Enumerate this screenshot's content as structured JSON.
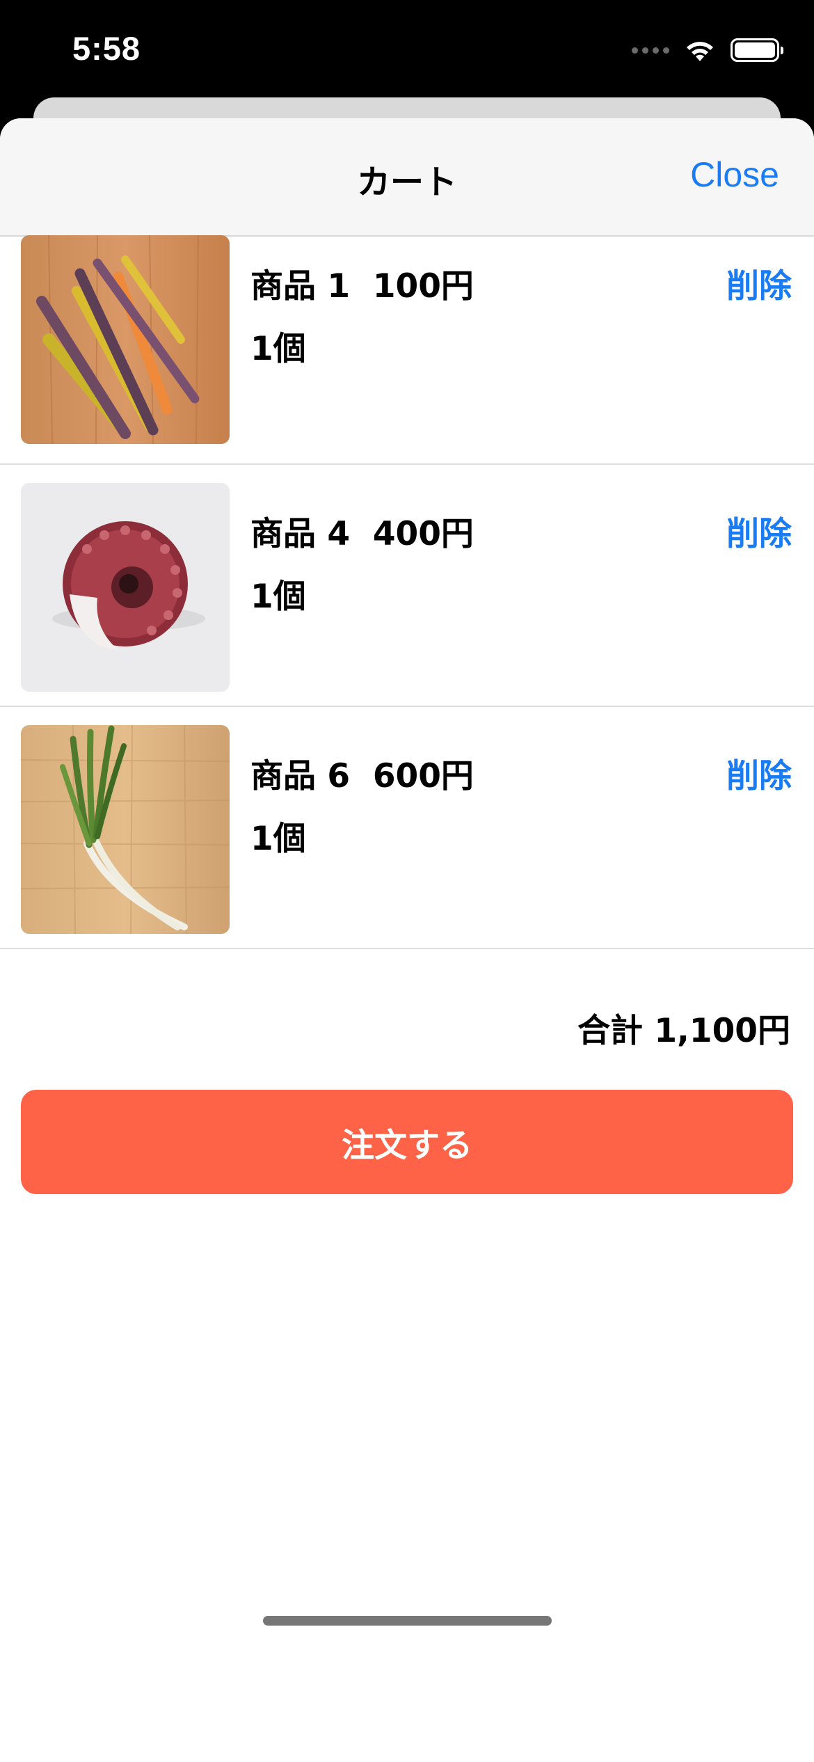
{
  "status_bar": {
    "time": "5:58"
  },
  "nav": {
    "title": "カート",
    "close_label": "Close"
  },
  "cart": {
    "items": [
      {
        "name": "商品 1",
        "price": "100円",
        "quantity": "1個",
        "delete_label": "削除",
        "image": "carrots"
      },
      {
        "name": "商品 4",
        "price": "400円",
        "quantity": "1個",
        "delete_label": "削除",
        "image": "octopus-tentacle"
      },
      {
        "name": "商品 6",
        "price": "600円",
        "quantity": "1個",
        "delete_label": "削除",
        "image": "green-onion"
      }
    ],
    "total_label": "合計 1,100円",
    "order_button_label": "注文する"
  },
  "colors": {
    "accent": "#1a7cf5",
    "order_button": "#ff6347"
  }
}
